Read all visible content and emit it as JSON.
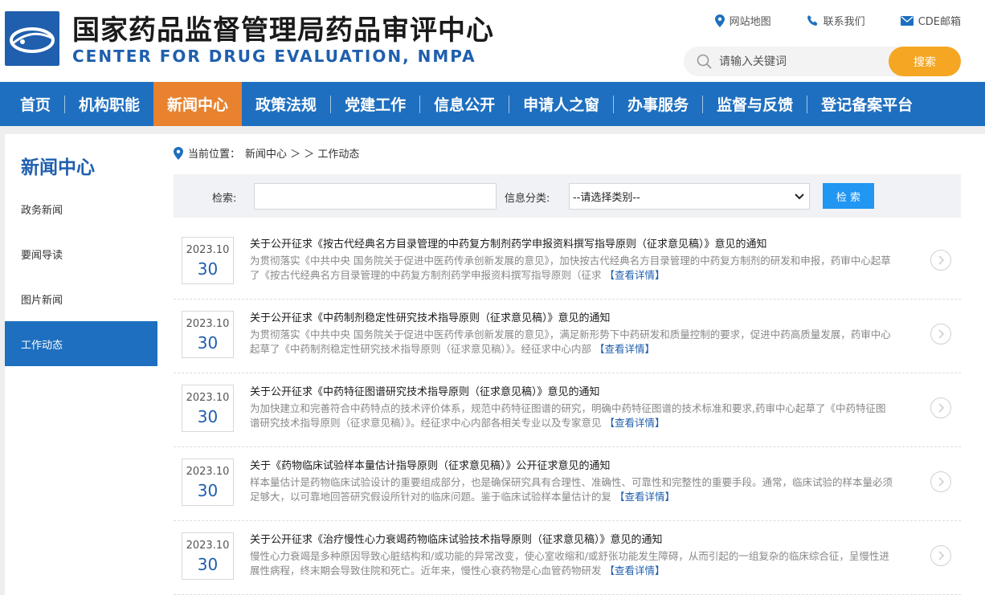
{
  "header": {
    "title_cn": "国家药品监督管理局药品审评中心",
    "title_en": "CENTER FOR DRUG EVALUATION, NMPA",
    "links": [
      {
        "label": "网站地图",
        "icon": "location-pin-icon"
      },
      {
        "label": "联系我们",
        "icon": "phone-icon"
      },
      {
        "label": "CDE邮箱",
        "icon": "mail-icon"
      }
    ],
    "search_placeholder": "请输入关键词",
    "search_button": "搜索"
  },
  "nav": {
    "items": [
      {
        "label": "首页"
      },
      {
        "label": "机构职能"
      },
      {
        "label": "新闻中心"
      },
      {
        "label": "政策法规"
      },
      {
        "label": "党建工作"
      },
      {
        "label": "信息公开"
      },
      {
        "label": "申请人之窗"
      },
      {
        "label": "办事服务"
      },
      {
        "label": "监督与反馈"
      },
      {
        "label": "登记备案平台"
      }
    ],
    "active_index": 2
  },
  "sidebar": {
    "title": "新闻中心",
    "items": [
      {
        "label": "政务新闻"
      },
      {
        "label": "要闻导读"
      },
      {
        "label": "图片新闻"
      },
      {
        "label": "工作动态"
      }
    ],
    "active_index": 3
  },
  "breadcrumb": {
    "prefix": "当前位置：",
    "path": "新闻中心 ＞ ＞ 工作动态"
  },
  "filter": {
    "search_label": "检索:",
    "search_value": "",
    "category_label": "信息分类:",
    "category_selected": "--请选择类别--",
    "submit_label": "检 索"
  },
  "news": [
    {
      "year_month": "2023.10",
      "day": "30",
      "title": "关于公开征求《按古代经典名方目录管理的中药复方制剂药学申报资料撰写指导原则（征求意见稿）》意见的通知",
      "summary": "为贯彻落实《中共中央 国务院关于促进中医药传承创新发展的意见》，加快按古代经典名方目录管理的中药复方制剂的研发和申报，药审中心起草了《按古代经典名方目录管理的中药复方制剂药学申报资料撰写指导原则（征求",
      "more": "【查看详情】"
    },
    {
      "year_month": "2023.10",
      "day": "30",
      "title": "关于公开征求《中药制剂稳定性研究技术指导原则（征求意见稿）》意见的通知",
      "summary": "为贯彻落实《中共中央 国务院关于促进中医药传承创新发展的意见》，满足新形势下中药研发和质量控制的要求，促进中药高质量发展，药审中心起草了《中药制剂稳定性研究技术指导原则（征求意见稿）》。经征求中心内部",
      "more": "【查看详情】"
    },
    {
      "year_month": "2023.10",
      "day": "30",
      "title": "关于公开征求《中药特征图谱研究技术指导原则（征求意见稿）》意见的通知",
      "summary": "为加快建立和完善符合中药特点的技术评价体系，规范中药特征图谱的研究，明确中药特征图谱的技术标准和要求,药审中心起草了《中药特征图谱研究技术指导原则（征求意见稿）》。经征求中心内部各相关专业以及专家意见",
      "more": "【查看详情】"
    },
    {
      "year_month": "2023.10",
      "day": "30",
      "title": "关于《药物临床试验样本量估计指导原则（征求意见稿）》公开征求意见的通知",
      "summary": "样本量估计是药物临床试验设计的重要组成部分，也是确保研究具有合理性、准确性、可靠性和完整性的重要手段。通常，临床试验的样本量必须足够大，以可靠地回答研究假设所针对的临床问题。鉴于临床试验样本量估计的复",
      "more": "【查看详情】"
    },
    {
      "year_month": "2023.10",
      "day": "30",
      "title": "关于公开征求《治疗慢性心力衰竭药物临床试验技术指导原则（征求意见稿）》意见的通知",
      "summary": "慢性心力衰竭是多种原因导致心脏结构和/或功能的异常改变，使心室收缩和/或舒张功能发生障碍，从而引起的一组复杂的临床综合征，呈慢性进展性病程，终末期会导致住院和死亡。近年来，慢性心衰药物是心血管药物研发",
      "more": "【查看详情】"
    }
  ]
}
